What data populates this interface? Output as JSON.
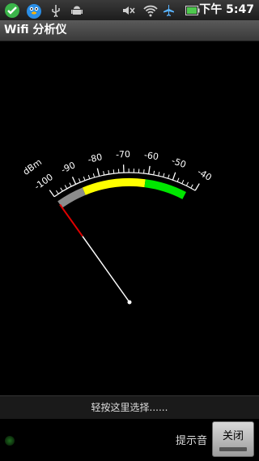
{
  "status_bar": {
    "icons": [
      "shield-check-icon",
      "qq-penguin-icon",
      "usb-icon",
      "android-debug-icon",
      "mute-icon",
      "wifi-icon",
      "airplane-icon",
      "battery-icon"
    ],
    "time": "下午 5:47"
  },
  "app": {
    "title": "Wifi 分析仪"
  },
  "meter": {
    "unit": "dBm",
    "ticks": [
      "-100",
      "-90",
      "-80",
      "-70",
      "-60",
      "-50",
      "-40"
    ],
    "needle_value": -100,
    "zone_colors": {
      "weak": "#8c8c8c",
      "fair": "#ffff00",
      "good": "#00e600",
      "needle_tip": "#e00000"
    },
    "zones": [
      {
        "name": "weak",
        "from": -100,
        "to": -88
      },
      {
        "name": "fair",
        "from": -88,
        "to": -61
      },
      {
        "name": "good",
        "from": -61,
        "to": -43
      }
    ]
  },
  "select_prompt": "轻按这里选择......",
  "bottom": {
    "hint_label": "提示音",
    "close_label": "关闭"
  }
}
